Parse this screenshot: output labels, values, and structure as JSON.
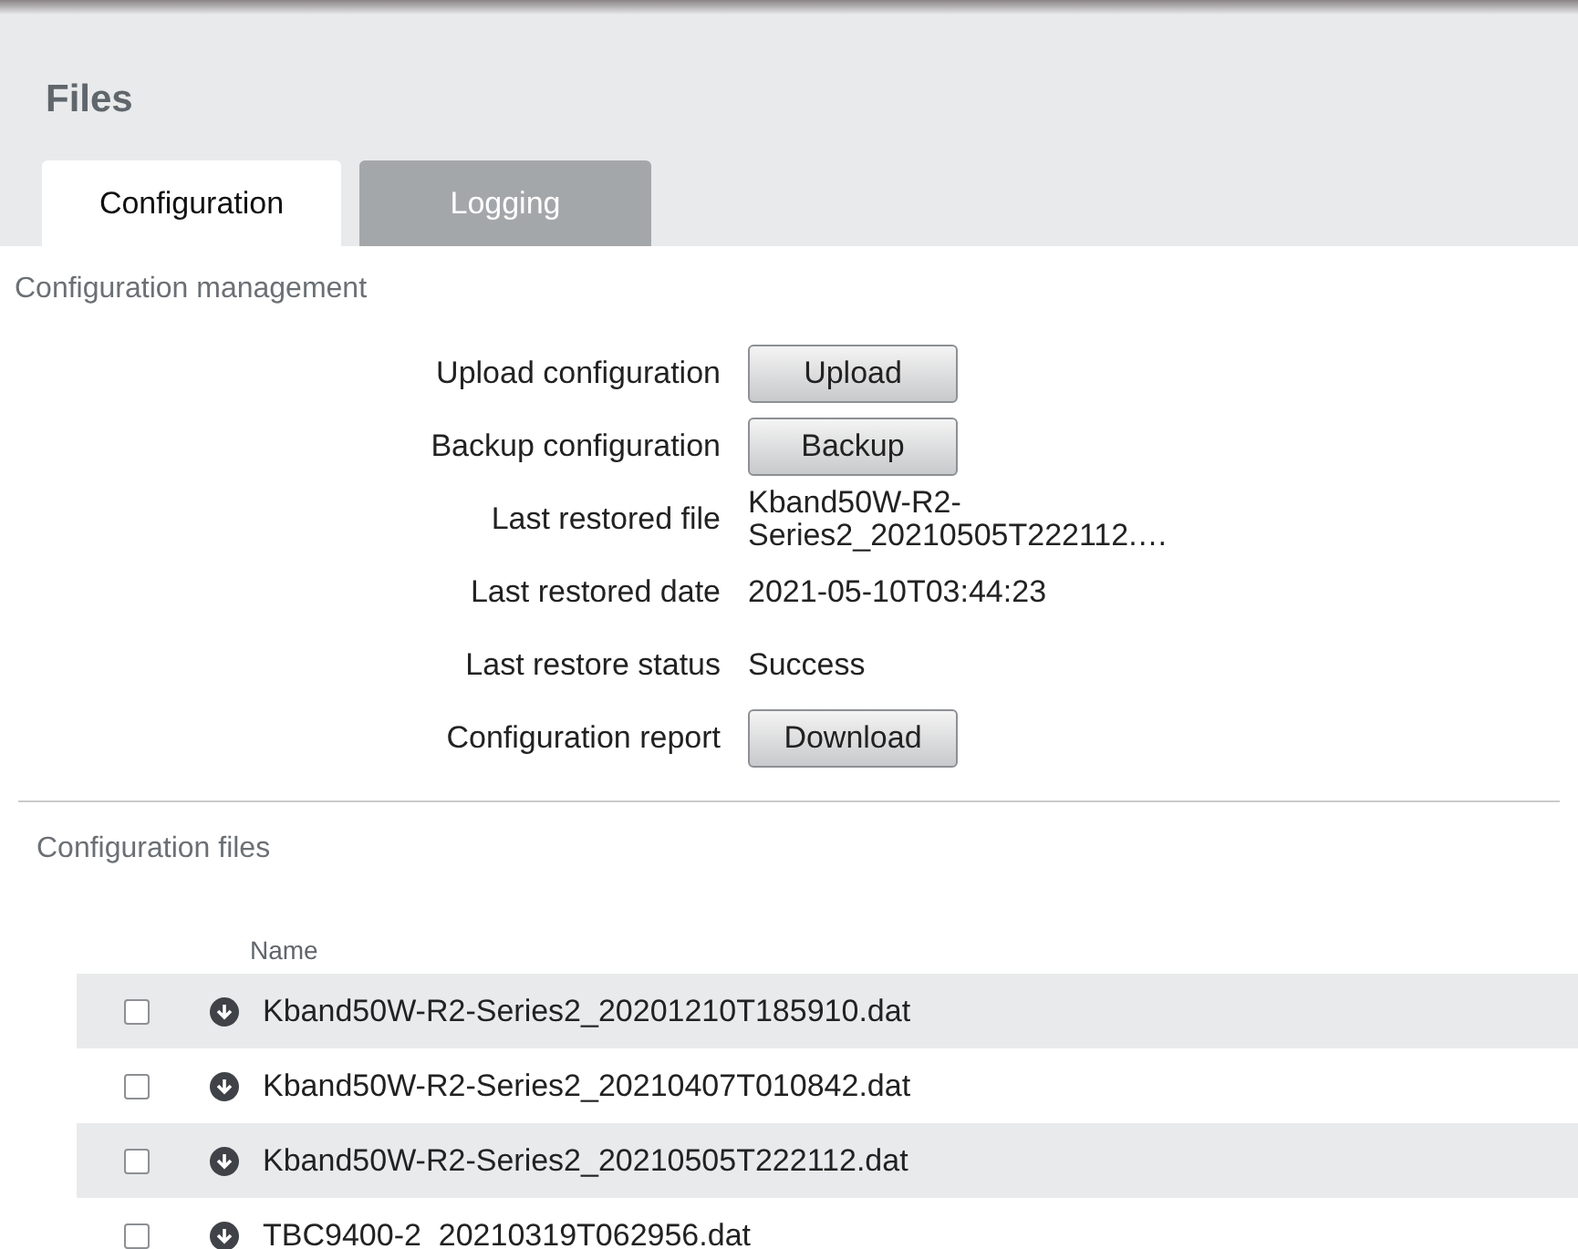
{
  "page": {
    "title": "Files"
  },
  "tabs": [
    {
      "label": "Configuration",
      "selected": true
    },
    {
      "label": "Logging",
      "selected": false
    }
  ],
  "management": {
    "title": "Configuration management",
    "rows": [
      {
        "kind": "button",
        "label": "Upload configuration",
        "value": "Upload"
      },
      {
        "kind": "button",
        "label": "Backup configuration",
        "value": "Backup"
      },
      {
        "kind": "text",
        "label": "Last restored file",
        "value": "Kband50W-R2-Series2_20210505T222112.…"
      },
      {
        "kind": "text",
        "label": "Last restored date",
        "value": "2021-05-10T03:44:23"
      },
      {
        "kind": "text",
        "label": "Last restore status",
        "value": "Success"
      },
      {
        "kind": "button",
        "label": "Configuration report",
        "value": "Download"
      }
    ]
  },
  "files": {
    "title": "Configuration files",
    "columns": [
      "Name"
    ],
    "rows": [
      {
        "name": "Kband50W-R2-Series2_20201210T185910.dat",
        "checked": false
      },
      {
        "name": "Kband50W-R2-Series2_20210407T010842.dat",
        "checked": false
      },
      {
        "name": "Kband50W-R2-Series2_20210505T222112.dat",
        "checked": false
      },
      {
        "name": "TBC9400-2_20210319T062956.dat",
        "checked": false
      }
    ]
  }
}
